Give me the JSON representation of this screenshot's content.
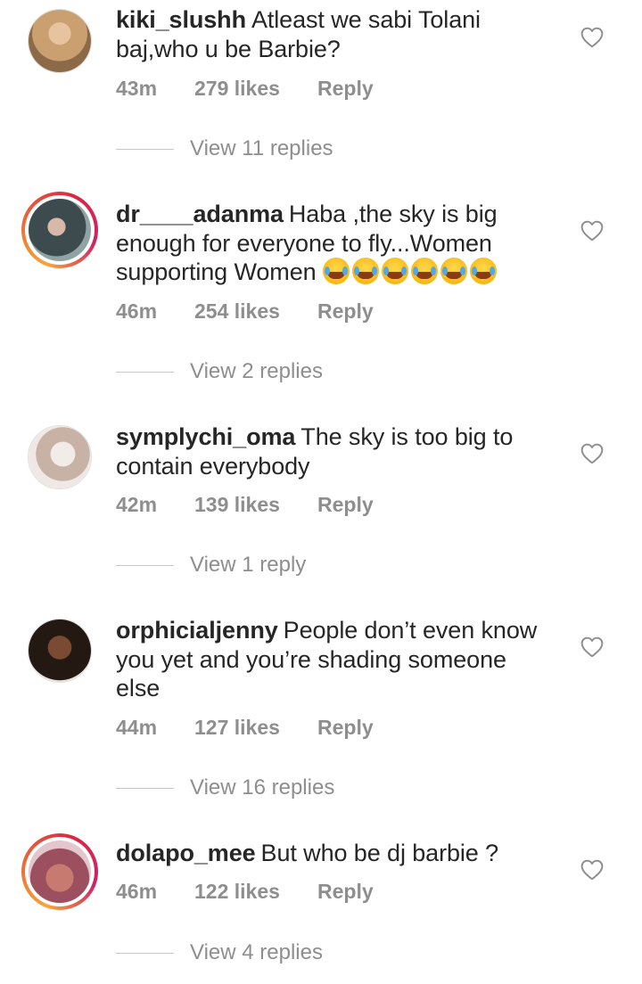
{
  "comments": [
    {
      "username": "kiki_slushh",
      "text": "Atleast we sabi Tolani baj,who u be Barbie?",
      "time": "43m",
      "likes": "279 likes",
      "reply": "Reply",
      "view_replies": "View 11 replies",
      "avatar_ring": false,
      "avatar_color": "#c79a6d"
    },
    {
      "username": "dr____adanma",
      "text": "Haba ,the sky is big enough for everyone to fly...Women supporting Women",
      "emoji_count": 6,
      "emoji_icon": "face-with-tears-of-joy-icon",
      "time": "46m",
      "likes": "254 likes",
      "reply": "Reply",
      "view_replies": "View 2 replies",
      "avatar_ring": true,
      "avatar_color": "#5b6a6e"
    },
    {
      "username": "symplychi_oma",
      "text": "The sky is too big to contain everybody",
      "time": "42m",
      "likes": "139 likes",
      "reply": "Reply",
      "view_replies": "View 1 reply",
      "avatar_ring": false,
      "avatar_color": "#b9a59a"
    },
    {
      "username": "orphicialjenny",
      "text": "People don’t even know you yet  and you’re shading someone else",
      "time": "44m",
      "likes": "127 likes",
      "reply": "Reply",
      "view_replies": "View 16 replies",
      "avatar_ring": false,
      "avatar_color": "#3a2a24"
    },
    {
      "username": "dolapo_mee",
      "text": "But who be dj barbie ?",
      "time": "46m",
      "likes": "122 likes",
      "reply": "Reply",
      "view_replies": "View 4 replies",
      "avatar_ring": true,
      "avatar_color": "#b26b7a"
    }
  ],
  "icons": {
    "like": "heart-outline-icon"
  },
  "colors": {
    "text": "#262626",
    "meta": "#8e8e8e",
    "divider": "#c7c7c7"
  }
}
